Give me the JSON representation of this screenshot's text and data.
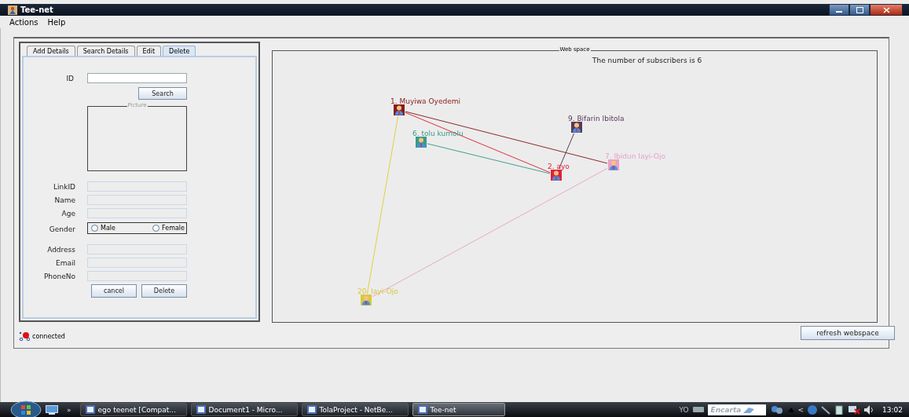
{
  "window": {
    "title": "Tee-net"
  },
  "menu": [
    "Actions",
    "Help"
  ],
  "tabs": [
    {
      "label": "Add Details",
      "selected": false
    },
    {
      "label": "Search Details",
      "selected": false
    },
    {
      "label": "Edit",
      "selected": false
    },
    {
      "label": "Delete",
      "selected": true
    }
  ],
  "form": {
    "id_label": "ID",
    "id_disabled": false,
    "search_button": "Search",
    "picture_label": "Picture",
    "fields": [
      {
        "kind": "text",
        "label": "LinkID",
        "disabled": true
      },
      {
        "kind": "text",
        "label": "Name",
        "disabled": true
      },
      {
        "kind": "text",
        "label": "Age",
        "disabled": true
      },
      {
        "kind": "radio",
        "label": "Gender",
        "options": [
          {
            "label": "Male",
            "selected": false
          },
          {
            "label": "Female",
            "selected": false
          }
        ]
      },
      {
        "kind": "text",
        "label": "Address",
        "disabled": true
      },
      {
        "kind": "text",
        "label": "Email",
        "disabled": true
      },
      {
        "kind": "text",
        "label": "PhoneNo",
        "disabled": true
      }
    ],
    "buttons": [
      "cancel",
      "Delete"
    ]
  },
  "status": {
    "text": "connected"
  },
  "webspace": {
    "title": "Web space",
    "summary": "The number of subscribers is 6",
    "nodes": [
      {
        "label": "1. Muyiwa Oyedemi",
        "color": "#8b1a1a"
      },
      {
        "label": "6. tolu kumolu",
        "color": "#3a9a8a"
      },
      {
        "label": "9. Bifarin Ibitola",
        "color": "#5a3a5a"
      },
      {
        "label": "2. ayo",
        "color": "#e0203a"
      },
      {
        "label": "7. Ibidun Iayi-Ojo",
        "color": "#e8a0c8"
      },
      {
        "label": "20. Iayi-Ojo",
        "color": "#d8c840"
      }
    ],
    "edges": [
      {
        "color": "#e03040"
      },
      {
        "color": "#8b2a2a"
      },
      {
        "color": "#40a090"
      },
      {
        "color": "#5a3a5a"
      },
      {
        "color": "#e8a8cc"
      },
      {
        "color": "#e0d040"
      }
    ]
  },
  "refresh_button": "refresh webspace",
  "taskbar": {
    "more": "»",
    "tasks": [
      {
        "label": "ego teenet [Compat...",
        "selected": false
      },
      {
        "label": "Document1 - Micro...",
        "selected": false
      },
      {
        "label": "TolaProject - NetBe...",
        "selected": false
      },
      {
        "label": "Tee-net",
        "selected": true
      }
    ],
    "language": "YO",
    "search_placeholder": "Encarta",
    "tray_toggle": "<",
    "clock": "13:02"
  }
}
